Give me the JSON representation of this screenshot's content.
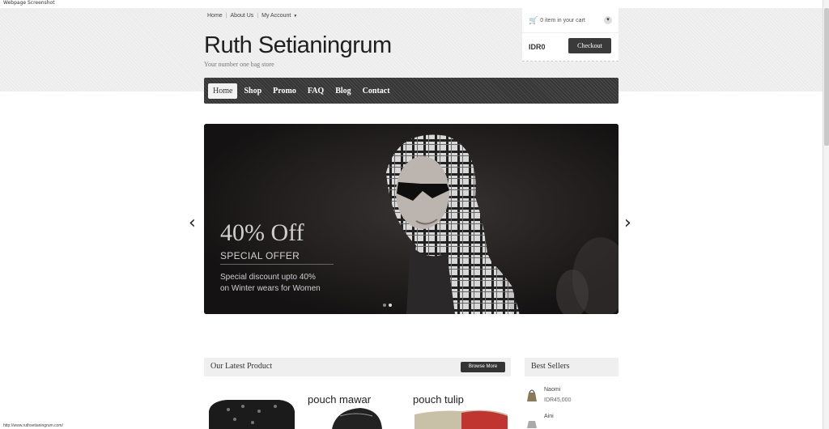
{
  "window": {
    "title": "Webpage Screenshot"
  },
  "top_links": {
    "home": "Home",
    "about": "About Us",
    "account": "My Account"
  },
  "site": {
    "title": "Ruth Setianingrum",
    "tagline": "Your number one bag store"
  },
  "cart": {
    "summary": "0 item in your cart",
    "total": "IDR0",
    "checkout_label": "Checkout"
  },
  "nav": {
    "items": [
      {
        "label": "Home",
        "active": true
      },
      {
        "label": "Shop"
      },
      {
        "label": "Promo"
      },
      {
        "label": "FAQ"
      },
      {
        "label": "Blog"
      },
      {
        "label": "Contact"
      }
    ]
  },
  "slider": {
    "headline": "40% Off",
    "subheadline": "SPECIAL OFFER",
    "description_line1": "Special discount upto 40%",
    "description_line2": "on Winter wears for Women",
    "slide_count": 2,
    "active_slide": 2
  },
  "latest": {
    "title": "Our Latest Product",
    "browse_label": "Browse More",
    "products": [
      {
        "label": ""
      },
      {
        "label": "pouch mawar"
      },
      {
        "label": "pouch tulip"
      }
    ]
  },
  "best_sellers": {
    "title": "Best Sellers",
    "items": [
      {
        "name": "Naomi",
        "price": "IDR45,000"
      },
      {
        "name": "Aini",
        "price": ""
      }
    ]
  },
  "status_bar": {
    "url": "http://www.ruthsetianingrum.com/"
  },
  "colors": {
    "nav_bg": "#3e3e3e",
    "header_bg": "#ececec",
    "button_dark": "#333333"
  }
}
